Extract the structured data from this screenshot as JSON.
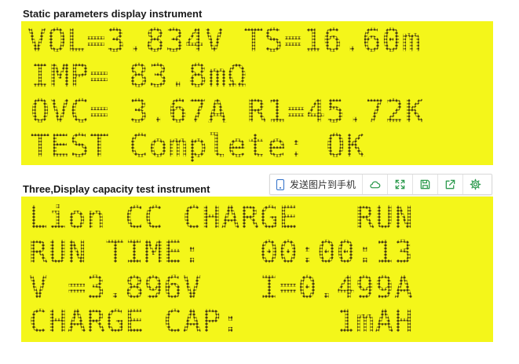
{
  "sections": [
    {
      "caption": "Static parameters display instrument",
      "lines": [
        "VOL=3.834V TS=16.60m",
        "IMP= 83.8mΩ",
        "OVC= 3.67A R1=45.72K",
        "TEST Complete: OK"
      ]
    },
    {
      "caption": "Three,Display capacity test instrument",
      "lines": [
        "Lion CC CHARGE   RUN",
        "RUN TIME:   00:00:13",
        "V =3.896V   I=0.499A",
        "CHARGE CAP:     1mAH"
      ]
    }
  ],
  "toolbar": {
    "send_label": "发送图片到手机",
    "icons": [
      "cloud-icon",
      "expand-icon",
      "save-icon",
      "share-icon",
      "settings-icon"
    ],
    "accent": "#2e9b4f",
    "phone_color": "#2f6fc9"
  },
  "colors": {
    "lcd_background": "#f4f61a",
    "lcd_text": "#4a3d10"
  }
}
